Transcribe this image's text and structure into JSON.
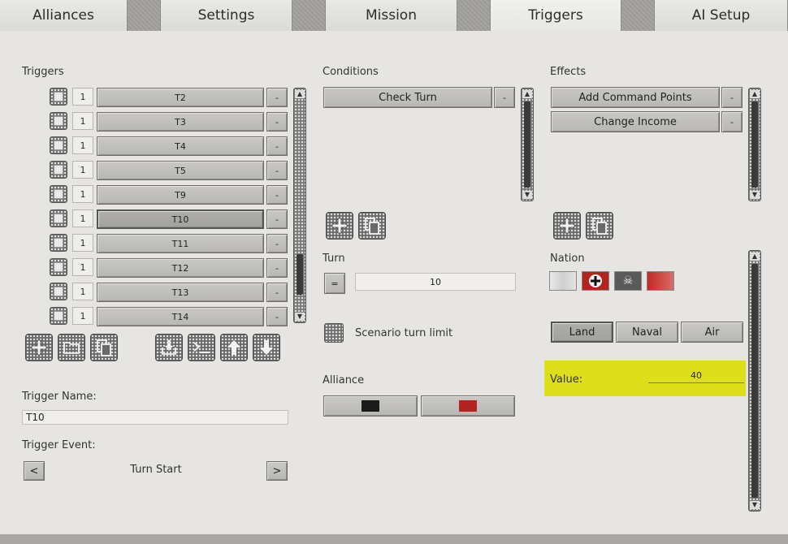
{
  "tabs": [
    {
      "label": "Alliances"
    },
    {
      "label": "Settings"
    },
    {
      "label": "Mission"
    },
    {
      "label": "Triggers"
    },
    {
      "label": "AI Setup"
    }
  ],
  "triggers_panel": {
    "title": "Triggers",
    "rows": [
      {
        "num": "1",
        "name": "T2",
        "minus": "-"
      },
      {
        "num": "1",
        "name": "T3",
        "minus": "-"
      },
      {
        "num": "1",
        "name": "T4",
        "minus": "-"
      },
      {
        "num": "1",
        "name": "T5",
        "minus": "-"
      },
      {
        "num": "1",
        "name": "T9",
        "minus": "-"
      },
      {
        "num": "1",
        "name": "T10",
        "minus": "-"
      },
      {
        "num": "1",
        "name": "T11",
        "minus": "-"
      },
      {
        "num": "1",
        "name": "T12",
        "minus": "-"
      },
      {
        "num": "1",
        "name": "T13",
        "minus": "-"
      },
      {
        "num": "1",
        "name": "T14",
        "minus": "-"
      }
    ],
    "selected_index": 5,
    "name_label": "Trigger Name:",
    "name_value": "T10",
    "event_label": "Trigger Event:",
    "event_value": "Turn Start",
    "prev": "<",
    "next": ">"
  },
  "conditions": {
    "title": "Conditions",
    "items": [
      {
        "label": "Check Turn",
        "minus": "-"
      }
    ],
    "turn_label": "Turn",
    "turn_operator": "=",
    "turn_value": "10",
    "scenario_turn_limit": "Scenario turn limit",
    "alliance_label": "Alliance",
    "alliance_colors": [
      "#1a1a1a",
      "#b3231f"
    ]
  },
  "effects": {
    "title": "Effects",
    "items": [
      {
        "label": "Add Command Points",
        "minus": "-"
      },
      {
        "label": "Change Income",
        "minus": "-"
      }
    ],
    "nation_label": "Nation",
    "unit_types": [
      "Land",
      "Naval",
      "Air"
    ],
    "unit_type_selected": "Land",
    "value_label": "Value:",
    "value": "40",
    "highlight_color": "#dede1a"
  },
  "icons": [
    "add-icon",
    "folder-icon",
    "copy-icon",
    "import-icon",
    "console-icon",
    "arrow-up-icon",
    "arrow-down-icon"
  ]
}
